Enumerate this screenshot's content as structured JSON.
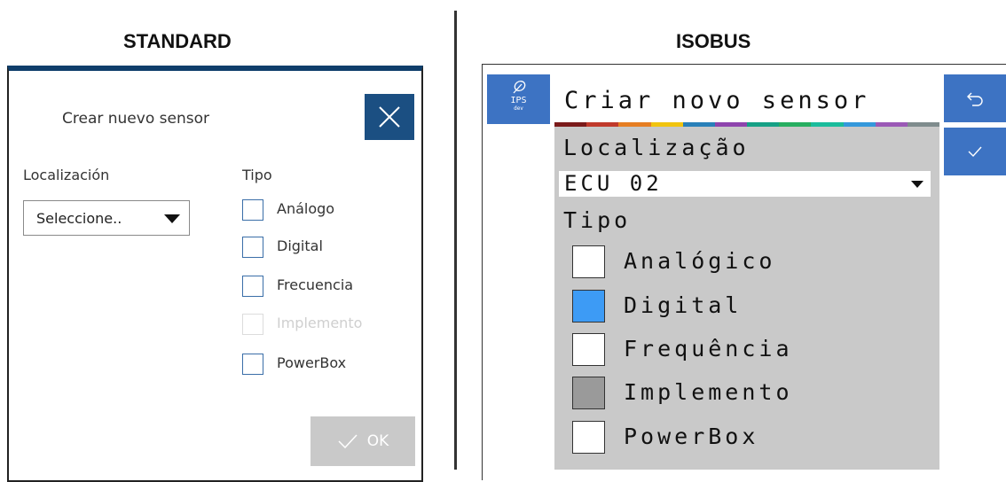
{
  "headings": {
    "standard": "STANDARD",
    "isobus": "ISOBUS"
  },
  "standard": {
    "title": "Crear nuevo sensor",
    "close_icon": "close-icon",
    "location_label": "Localización",
    "location_value": "Seleccione..",
    "type_label": "Tipo",
    "options": [
      {
        "label": "Análogo",
        "checked": false,
        "enabled": true
      },
      {
        "label": "Digital",
        "checked": false,
        "enabled": true
      },
      {
        "label": "Frecuencia",
        "checked": false,
        "enabled": true
      },
      {
        "label": "Implemento",
        "checked": false,
        "enabled": false
      },
      {
        "label": "PowerBox",
        "checked": false,
        "enabled": true
      }
    ],
    "ok_label": "OK",
    "colors": {
      "header_bar": "#0f3e6b",
      "close_button": "#1b4f82",
      "ok_button_disabled": "#c9c9c9",
      "checkbox_border": "#3a6ea8"
    }
  },
  "isobus": {
    "logo_label": "IPS",
    "logo_sub": "dev",
    "title": "Criar novo sensor",
    "location_label": "Localização",
    "location_value": "ECU 02",
    "type_label": "Tipo",
    "options": [
      {
        "label": "Analógico",
        "state": "unchecked"
      },
      {
        "label": "Digital",
        "state": "checked"
      },
      {
        "label": "Frequência",
        "state": "unchecked"
      },
      {
        "label": "Implemento",
        "state": "disabled"
      },
      {
        "label": "PowerBox",
        "state": "unchecked"
      }
    ],
    "buttons": {
      "back_icon": "undo-arrow-icon",
      "confirm_icon": "check-icon"
    },
    "colors": {
      "accent": "#3d73c3",
      "checked_fill": "#3d9bf5",
      "disabled_fill": "#9a9a9a",
      "content_bg": "#c9c9c9",
      "title_bar_stripes": [
        "#7a1a1a",
        "#c0392b",
        "#e67e22",
        "#f1c40f",
        "#2980b9",
        "#8e44ad",
        "#16a085",
        "#27ae60",
        "#1abc9c",
        "#3498db",
        "#9b59b6",
        "#7f8c8d"
      ]
    }
  }
}
